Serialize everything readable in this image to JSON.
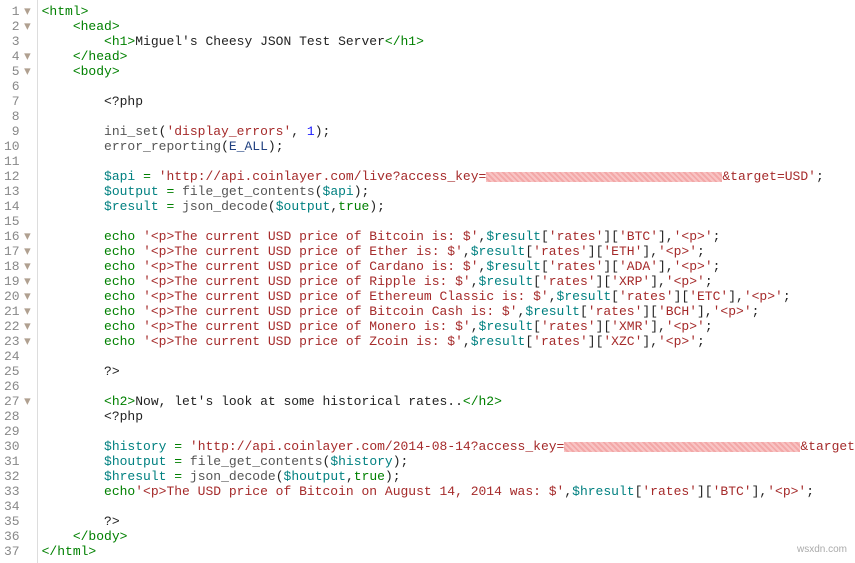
{
  "watermark": "wsxdn.com",
  "fold_lines": [
    1,
    2,
    4,
    5,
    16,
    17,
    18,
    19,
    20,
    21,
    22,
    23,
    27
  ],
  "lines": [
    {
      "n": 1,
      "tokens": [
        {
          "cls": "tag",
          "t": "<html>"
        }
      ]
    },
    {
      "n": 2,
      "indent": 1,
      "tokens": [
        {
          "cls": "tag",
          "t": "<head>"
        }
      ]
    },
    {
      "n": 3,
      "indent": 2,
      "tokens": [
        {
          "cls": "tag",
          "t": "<h1>"
        },
        {
          "cls": "text",
          "t": "Miguel's Cheesy JSON Test Server"
        },
        {
          "cls": "tag",
          "t": "</h1>"
        }
      ]
    },
    {
      "n": 4,
      "indent": 1,
      "tokens": [
        {
          "cls": "tag",
          "t": "</head>"
        }
      ]
    },
    {
      "n": 5,
      "indent": 1,
      "tokens": [
        {
          "cls": "tag",
          "t": "<body>"
        }
      ]
    },
    {
      "n": 6,
      "tokens": []
    },
    {
      "n": 7,
      "indent": 2,
      "tokens": [
        {
          "cls": "text",
          "t": "<?php"
        }
      ]
    },
    {
      "n": 8,
      "tokens": []
    },
    {
      "n": 9,
      "indent": 2,
      "tokens": [
        {
          "cls": "func",
          "t": "ini_set"
        },
        {
          "cls": "text",
          "t": "("
        },
        {
          "cls": "string",
          "t": "'display_errors'"
        },
        {
          "cls": "text",
          "t": ", "
        },
        {
          "cls": "num",
          "t": "1"
        },
        {
          "cls": "text",
          "t": ");"
        }
      ]
    },
    {
      "n": 10,
      "indent": 2,
      "tokens": [
        {
          "cls": "func",
          "t": "error_reporting"
        },
        {
          "cls": "text",
          "t": "("
        },
        {
          "cls": "const",
          "t": "E_ALL"
        },
        {
          "cls": "text",
          "t": ");"
        }
      ]
    },
    {
      "n": 11,
      "tokens": []
    },
    {
      "n": 12,
      "indent": 2,
      "tokens": [
        {
          "cls": "var",
          "t": "$api"
        },
        {
          "cls": "text",
          "t": " "
        },
        {
          "cls": "op",
          "t": "="
        },
        {
          "cls": "text",
          "t": " "
        },
        {
          "cls": "string",
          "t": "'http://api.coinlayer.com/live?access_key="
        },
        {
          "censor": 236
        },
        {
          "cls": "string",
          "t": "&target=USD'"
        },
        {
          "cls": "text",
          "t": ";"
        }
      ]
    },
    {
      "n": 13,
      "indent": 2,
      "tokens": [
        {
          "cls": "var",
          "t": "$output"
        },
        {
          "cls": "text",
          "t": " "
        },
        {
          "cls": "op",
          "t": "="
        },
        {
          "cls": "text",
          "t": " "
        },
        {
          "cls": "func",
          "t": "file_get_contents"
        },
        {
          "cls": "text",
          "t": "("
        },
        {
          "cls": "var",
          "t": "$api"
        },
        {
          "cls": "text",
          "t": ");"
        }
      ]
    },
    {
      "n": 14,
      "indent": 2,
      "tokens": [
        {
          "cls": "var",
          "t": "$result"
        },
        {
          "cls": "text",
          "t": " "
        },
        {
          "cls": "op",
          "t": "="
        },
        {
          "cls": "text",
          "t": " "
        },
        {
          "cls": "func",
          "t": "json_decode"
        },
        {
          "cls": "text",
          "t": "("
        },
        {
          "cls": "var",
          "t": "$output"
        },
        {
          "cls": "text",
          "t": ","
        },
        {
          "cls": "keyword",
          "t": "true"
        },
        {
          "cls": "text",
          "t": ");"
        }
      ]
    },
    {
      "n": 15,
      "tokens": []
    },
    {
      "n": 16,
      "indent": 2,
      "tokens": [
        {
          "cls": "keyword",
          "t": "echo"
        },
        {
          "cls": "text",
          "t": " "
        },
        {
          "cls": "string",
          "t": "'<p>The current USD price of Bitcoin is: $'"
        },
        {
          "cls": "text",
          "t": ","
        },
        {
          "cls": "var",
          "t": "$result"
        },
        {
          "cls": "text",
          "t": "["
        },
        {
          "cls": "string",
          "t": "'rates'"
        },
        {
          "cls": "text",
          "t": "]["
        },
        {
          "cls": "string",
          "t": "'BTC'"
        },
        {
          "cls": "text",
          "t": "],"
        },
        {
          "cls": "string",
          "t": "'<p>'"
        },
        {
          "cls": "text",
          "t": ";"
        }
      ]
    },
    {
      "n": 17,
      "indent": 2,
      "tokens": [
        {
          "cls": "keyword",
          "t": "echo"
        },
        {
          "cls": "text",
          "t": " "
        },
        {
          "cls": "string",
          "t": "'<p>The current USD price of Ether is: $'"
        },
        {
          "cls": "text",
          "t": ","
        },
        {
          "cls": "var",
          "t": "$result"
        },
        {
          "cls": "text",
          "t": "["
        },
        {
          "cls": "string",
          "t": "'rates'"
        },
        {
          "cls": "text",
          "t": "]["
        },
        {
          "cls": "string",
          "t": "'ETH'"
        },
        {
          "cls": "text",
          "t": "],"
        },
        {
          "cls": "string",
          "t": "'<p>'"
        },
        {
          "cls": "text",
          "t": ";"
        }
      ]
    },
    {
      "n": 18,
      "indent": 2,
      "tokens": [
        {
          "cls": "keyword",
          "t": "echo"
        },
        {
          "cls": "text",
          "t": " "
        },
        {
          "cls": "string",
          "t": "'<p>The current USD price of Cardano is: $'"
        },
        {
          "cls": "text",
          "t": ","
        },
        {
          "cls": "var",
          "t": "$result"
        },
        {
          "cls": "text",
          "t": "["
        },
        {
          "cls": "string",
          "t": "'rates'"
        },
        {
          "cls": "text",
          "t": "]["
        },
        {
          "cls": "string",
          "t": "'ADA'"
        },
        {
          "cls": "text",
          "t": "],"
        },
        {
          "cls": "string",
          "t": "'<p>'"
        },
        {
          "cls": "text",
          "t": ";"
        }
      ]
    },
    {
      "n": 19,
      "indent": 2,
      "tokens": [
        {
          "cls": "keyword",
          "t": "echo"
        },
        {
          "cls": "text",
          "t": " "
        },
        {
          "cls": "string",
          "t": "'<p>The current USD price of Ripple is: $'"
        },
        {
          "cls": "text",
          "t": ","
        },
        {
          "cls": "var",
          "t": "$result"
        },
        {
          "cls": "text",
          "t": "["
        },
        {
          "cls": "string",
          "t": "'rates'"
        },
        {
          "cls": "text",
          "t": "]["
        },
        {
          "cls": "string",
          "t": "'XRP'"
        },
        {
          "cls": "text",
          "t": "],"
        },
        {
          "cls": "string",
          "t": "'<p>'"
        },
        {
          "cls": "text",
          "t": ";"
        }
      ]
    },
    {
      "n": 20,
      "indent": 2,
      "tokens": [
        {
          "cls": "keyword",
          "t": "echo"
        },
        {
          "cls": "text",
          "t": " "
        },
        {
          "cls": "string",
          "t": "'<p>The current USD price of Ethereum Classic is: $'"
        },
        {
          "cls": "text",
          "t": ","
        },
        {
          "cls": "var",
          "t": "$result"
        },
        {
          "cls": "text",
          "t": "["
        },
        {
          "cls": "string",
          "t": "'rates'"
        },
        {
          "cls": "text",
          "t": "]["
        },
        {
          "cls": "string",
          "t": "'ETC'"
        },
        {
          "cls": "text",
          "t": "],"
        },
        {
          "cls": "string",
          "t": "'<p>'"
        },
        {
          "cls": "text",
          "t": ";"
        }
      ]
    },
    {
      "n": 21,
      "indent": 2,
      "tokens": [
        {
          "cls": "keyword",
          "t": "echo"
        },
        {
          "cls": "text",
          "t": " "
        },
        {
          "cls": "string",
          "t": "'<p>The current USD price of Bitcoin Cash is: $'"
        },
        {
          "cls": "text",
          "t": ","
        },
        {
          "cls": "var",
          "t": "$result"
        },
        {
          "cls": "text",
          "t": "["
        },
        {
          "cls": "string",
          "t": "'rates'"
        },
        {
          "cls": "text",
          "t": "]["
        },
        {
          "cls": "string",
          "t": "'BCH'"
        },
        {
          "cls": "text",
          "t": "],"
        },
        {
          "cls": "string",
          "t": "'<p>'"
        },
        {
          "cls": "text",
          "t": ";"
        }
      ]
    },
    {
      "n": 22,
      "indent": 2,
      "tokens": [
        {
          "cls": "keyword",
          "t": "echo"
        },
        {
          "cls": "text",
          "t": " "
        },
        {
          "cls": "string",
          "t": "'<p>The current USD price of Monero is: $'"
        },
        {
          "cls": "text",
          "t": ","
        },
        {
          "cls": "var",
          "t": "$result"
        },
        {
          "cls": "text",
          "t": "["
        },
        {
          "cls": "string",
          "t": "'rates'"
        },
        {
          "cls": "text",
          "t": "]["
        },
        {
          "cls": "string",
          "t": "'XMR'"
        },
        {
          "cls": "text",
          "t": "],"
        },
        {
          "cls": "string",
          "t": "'<p>'"
        },
        {
          "cls": "text",
          "t": ";"
        }
      ]
    },
    {
      "n": 23,
      "indent": 2,
      "tokens": [
        {
          "cls": "keyword",
          "t": "echo"
        },
        {
          "cls": "text",
          "t": " "
        },
        {
          "cls": "string",
          "t": "'<p>The current USD price of Zcoin is: $'"
        },
        {
          "cls": "text",
          "t": ","
        },
        {
          "cls": "var",
          "t": "$result"
        },
        {
          "cls": "text",
          "t": "["
        },
        {
          "cls": "string",
          "t": "'rates'"
        },
        {
          "cls": "text",
          "t": "]["
        },
        {
          "cls": "string",
          "t": "'XZC'"
        },
        {
          "cls": "text",
          "t": "],"
        },
        {
          "cls": "string",
          "t": "'<p>'"
        },
        {
          "cls": "text",
          "t": ";"
        }
      ]
    },
    {
      "n": 24,
      "tokens": []
    },
    {
      "n": 25,
      "indent": 2,
      "tokens": [
        {
          "cls": "text",
          "t": "?>"
        }
      ]
    },
    {
      "n": 26,
      "tokens": []
    },
    {
      "n": 27,
      "indent": 2,
      "tokens": [
        {
          "cls": "tag",
          "t": "<h2>"
        },
        {
          "cls": "text",
          "t": "Now, let's look at some historical rates.."
        },
        {
          "cls": "tag",
          "t": "</h2>"
        }
      ]
    },
    {
      "n": 28,
      "indent": 2,
      "tokens": [
        {
          "cls": "text",
          "t": "<?php"
        }
      ]
    },
    {
      "n": 29,
      "tokens": []
    },
    {
      "n": 30,
      "indent": 2,
      "tokens": [
        {
          "cls": "var",
          "t": "$history"
        },
        {
          "cls": "text",
          "t": " "
        },
        {
          "cls": "op",
          "t": "="
        },
        {
          "cls": "text",
          "t": " "
        },
        {
          "cls": "string",
          "t": "'http://api.coinlayer.com/2014-08-14?access_key="
        },
        {
          "censor": 236
        },
        {
          "cls": "string",
          "t": "&target=USD'"
        },
        {
          "cls": "text",
          "t": ";"
        }
      ]
    },
    {
      "n": 31,
      "indent": 2,
      "tokens": [
        {
          "cls": "var",
          "t": "$houtput"
        },
        {
          "cls": "text",
          "t": " "
        },
        {
          "cls": "op",
          "t": "="
        },
        {
          "cls": "text",
          "t": " "
        },
        {
          "cls": "func",
          "t": "file_get_contents"
        },
        {
          "cls": "text",
          "t": "("
        },
        {
          "cls": "var",
          "t": "$history"
        },
        {
          "cls": "text",
          "t": ");"
        }
      ]
    },
    {
      "n": 32,
      "indent": 2,
      "tokens": [
        {
          "cls": "var",
          "t": "$hresult"
        },
        {
          "cls": "text",
          "t": " "
        },
        {
          "cls": "op",
          "t": "="
        },
        {
          "cls": "text",
          "t": " "
        },
        {
          "cls": "func",
          "t": "json_decode"
        },
        {
          "cls": "text",
          "t": "("
        },
        {
          "cls": "var",
          "t": "$houtput"
        },
        {
          "cls": "text",
          "t": ","
        },
        {
          "cls": "keyword",
          "t": "true"
        },
        {
          "cls": "text",
          "t": ");"
        }
      ]
    },
    {
      "n": 33,
      "indent": 2,
      "tokens": [
        {
          "cls": "keyword",
          "t": "echo"
        },
        {
          "cls": "string",
          "t": "'<p>The USD price of Bitcoin on August 14, 2014 was: $'"
        },
        {
          "cls": "text",
          "t": ","
        },
        {
          "cls": "var",
          "t": "$hresult"
        },
        {
          "cls": "text",
          "t": "["
        },
        {
          "cls": "string",
          "t": "'rates'"
        },
        {
          "cls": "text",
          "t": "]["
        },
        {
          "cls": "string",
          "t": "'BTC'"
        },
        {
          "cls": "text",
          "t": "],"
        },
        {
          "cls": "string",
          "t": "'<p>'"
        },
        {
          "cls": "text",
          "t": ";"
        }
      ]
    },
    {
      "n": 34,
      "tokens": []
    },
    {
      "n": 35,
      "indent": 2,
      "tokens": [
        {
          "cls": "text",
          "t": "?>"
        }
      ]
    },
    {
      "n": 36,
      "indent": 1,
      "tokens": [
        {
          "cls": "tag",
          "t": "</body>"
        }
      ]
    },
    {
      "n": 37,
      "tokens": [
        {
          "cls": "tag",
          "t": "</html>"
        }
      ]
    }
  ]
}
